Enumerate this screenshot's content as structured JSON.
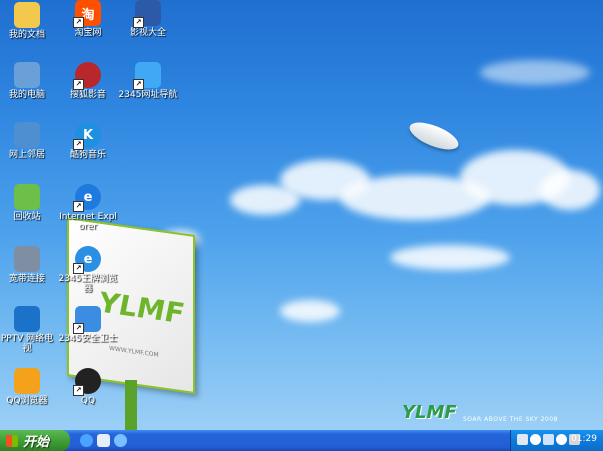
{
  "desktop_icons": [
    {
      "label": "我的文档",
      "icon": "documents-folder-icon",
      "color": "#f2c94c"
    },
    {
      "label": "淘宝网",
      "icon": "taobao-icon",
      "color": "#ff5000",
      "glyph_text": "淘"
    },
    {
      "label": "影视大全",
      "icon": "film-icon",
      "color": "#2d5aa8"
    },
    {
      "label": "我的电脑",
      "icon": "computer-icon",
      "color": "#6aa0d8"
    },
    {
      "label": "搜狐影音",
      "icon": "sohu-video-icon",
      "color": "#b8272b"
    },
    {
      "label": "2345网址导航",
      "icon": "nav-2345-icon",
      "color": "#3fa9f5"
    },
    {
      "label": "网上邻居",
      "icon": "network-icon",
      "color": "#4d8fd1"
    },
    {
      "label": "酷狗音乐",
      "icon": "kugou-icon",
      "color": "#1e8fe1",
      "glyph_text": "K"
    },
    {
      "label": "回收站",
      "icon": "recycle-bin-icon",
      "color": "#6cc04a"
    },
    {
      "label": "Internet Explorer",
      "icon": "ie-icon",
      "color": "#1f7ae0",
      "glyph_text": "e"
    },
    {
      "label": "宽带连接",
      "icon": "broadband-icon",
      "color": "#7e8fa3"
    },
    {
      "label": "2345王牌浏览器",
      "icon": "browser-2345-icon",
      "color": "#2b8fe3",
      "glyph_text": "e"
    },
    {
      "label": "PPTV 网络电视",
      "icon": "pptv-icon",
      "color": "#1b73c9"
    },
    {
      "label": "2345安全卫士",
      "icon": "security-2345-icon",
      "color": "#3a8de0"
    },
    {
      "label": "QQ浏览器",
      "icon": "qq-browser-icon",
      "color": "#f4a21b"
    },
    {
      "label": "QQ",
      "icon": "qq-icon",
      "color": "#222222"
    }
  ],
  "billboard": {
    "logo": "YLMF",
    "url": "WWW.YLMF.COM"
  },
  "watermark": {
    "logo": "YLMF",
    "slogan": "SOAR ABOVE THE SKY 2008"
  },
  "taskbar": {
    "start_label": "开始",
    "quick_launch": [
      {
        "name": "ie-quicklaunch-icon",
        "color": "#4aa3ff"
      },
      {
        "name": "media-quicklaunch-icon",
        "color": "#e6eef8"
      },
      {
        "name": "browser-quicklaunch-icon",
        "color": "#78c0ff"
      }
    ],
    "tray_icons": [
      {
        "name": "keyboard-tray-icon",
        "color": "#dfe8f5"
      },
      {
        "name": "volume-tray-icon",
        "color": "#ffffff"
      },
      {
        "name": "security-tray-icon",
        "color": "#cfe3ff"
      },
      {
        "name": "ime-tray-icon",
        "color": "#ffffff"
      },
      {
        "name": "network-tray-icon",
        "color": "#d6d6d6"
      }
    ],
    "clock": "01:29"
  }
}
